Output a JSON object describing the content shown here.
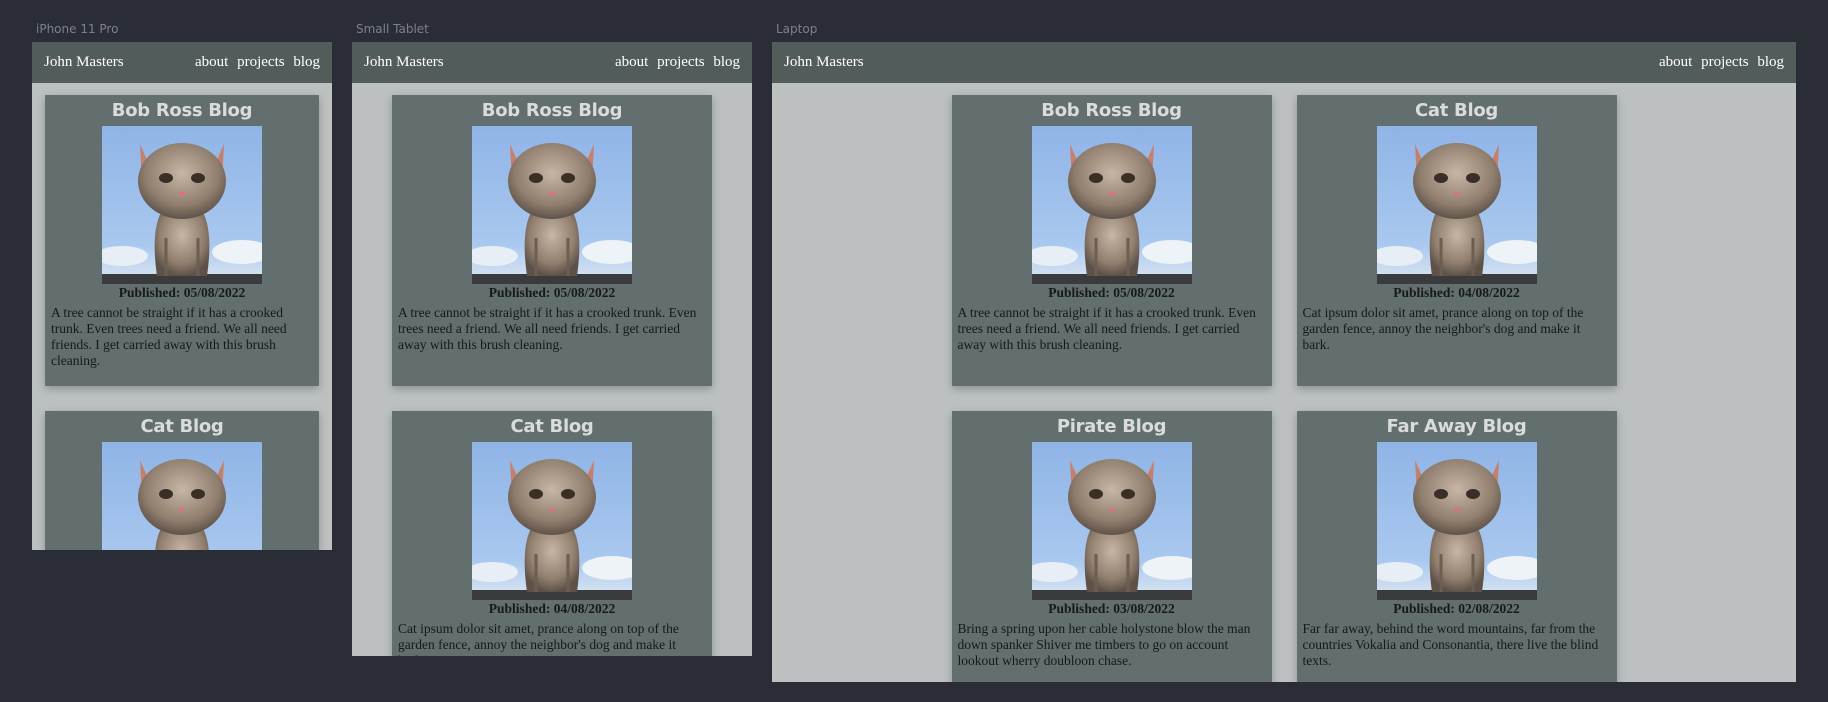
{
  "frames": {
    "mobile": {
      "label": "iPhone 11 Pro"
    },
    "tablet": {
      "label": "Small Tablet"
    },
    "laptop": {
      "label": "Laptop"
    }
  },
  "nav": {
    "brand": "John Masters",
    "links": [
      "about",
      "projects",
      "blog"
    ]
  },
  "posts": [
    {
      "title": "Bob Ross Blog",
      "published": "Published: 05/08/2022",
      "excerpt": "A tree cannot be straight if it has a crooked trunk. Even trees need a friend. We all need friends. I get carried away with this brush cleaning."
    },
    {
      "title": "Cat Blog",
      "published": "Published: 04/08/2022",
      "excerpt": "Cat ipsum dolor sit amet, prance along on top of the garden fence, annoy the neighbor's dog and make it bark."
    },
    {
      "title": "Pirate Blog",
      "published": "Published: 03/08/2022",
      "excerpt": "Bring a spring upon her cable holystone blow the man down spanker Shiver me timbers to go on account lookout wherry doubloon chase."
    },
    {
      "title": "Far Away Blog",
      "published": "Published: 02/08/2022",
      "excerpt": "Far far away, behind the word mountains, far from the countries Vokalia and Consonantia, there live the blind texts."
    }
  ],
  "colors": {
    "canvas": "#2a2d35",
    "page": "#bdc0c1",
    "navbar": "#525c5b",
    "card": "#636e6e"
  },
  "icons": {
    "post_image": "kitten-photo"
  }
}
